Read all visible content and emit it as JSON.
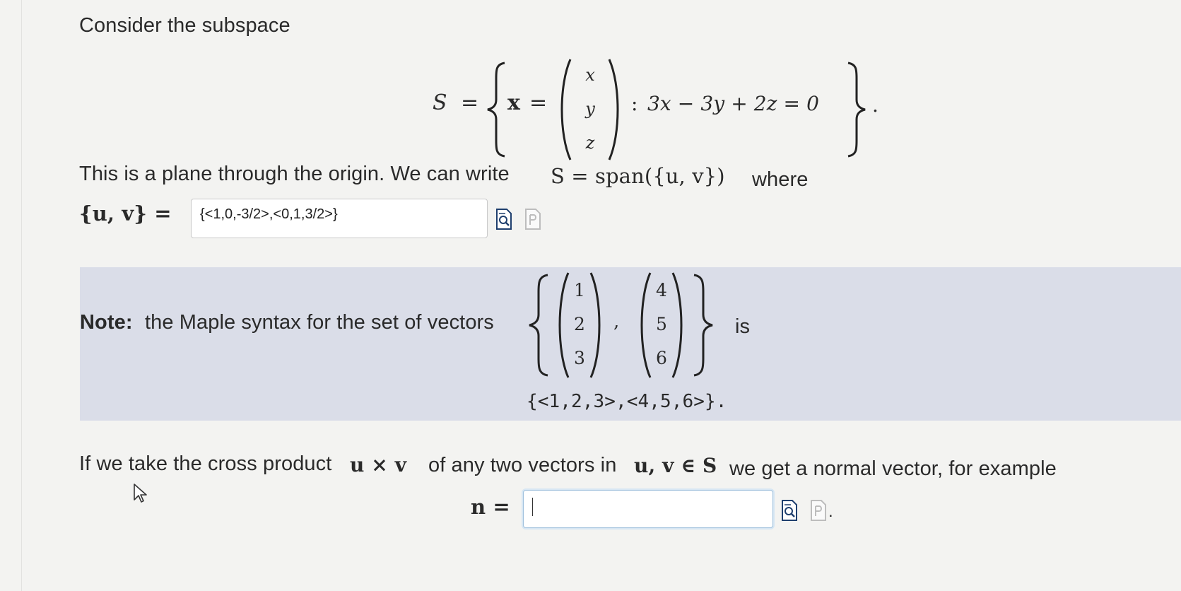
{
  "intro": {
    "text": "Consider the subspace"
  },
  "set_definition": {
    "set_name": "S",
    "element": "x",
    "vector_entries": [
      "x",
      "y",
      "z"
    ],
    "condition": "3x − 3y + 2z = 0",
    "end": "."
  },
  "plane_sentence": {
    "text_before": "This is a plane through the origin. We can write",
    "math": "S = span({u, v})",
    "text_after": "where"
  },
  "uv_answer": {
    "label": "{u, v} =",
    "value": "{<1,0,-3/2>,<0,1,3/2>}"
  },
  "note": {
    "bold": "Note:",
    "text": "the Maple syntax for the set of vectors",
    "vector1": [
      "1",
      "2",
      "3"
    ],
    "vector2": [
      "4",
      "5",
      "6"
    ],
    "is": "is",
    "maple_syntax": "{<1,2,3>,<4,5,6>}."
  },
  "cross_product": {
    "text_1": "If we take the cross product",
    "math_1": "u × v",
    "text_2": "of any two vectors in",
    "math_2": "u, v ∈ S",
    "text_3": "we get a normal vector, for example"
  },
  "n_answer": {
    "label": "n =",
    "value": "",
    "end": "."
  },
  "icons": {
    "preview": "preview-icon",
    "help": "maple-help-icon",
    "cursor": "mouse-pointer-icon"
  }
}
